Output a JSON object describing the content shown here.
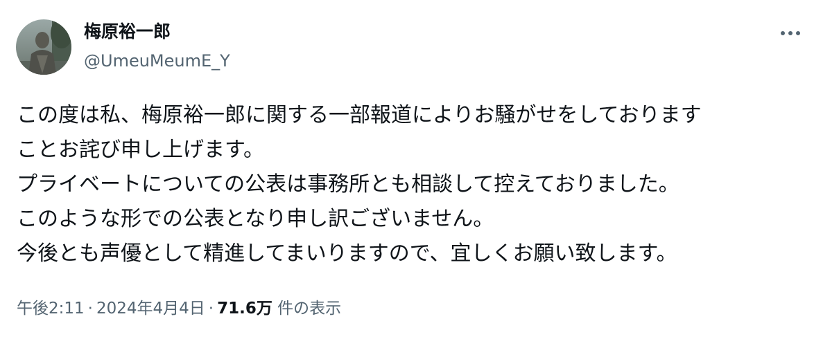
{
  "author": {
    "display_name": "梅原裕一郎",
    "handle": "@UmeuMeumE_Y",
    "avatar_icon": "avatar-photo-icon"
  },
  "more_menu": {
    "icon": "more-dots-icon"
  },
  "tweet": {
    "lines": [
      "この度は私、梅原裕一郎に関する一部報道によりお騒がせをしております",
      "ことお詫び申し上げます。",
      "プライベートについての公表は事務所とも相談して控えておりました。",
      "このような形での公表となり申し訳ございません。",
      "今後とも声優として精進してまいりますので、宜しくお願い致します。"
    ]
  },
  "meta": {
    "time": "午後2:11",
    "separator": "·",
    "date": "2024年4月4日",
    "views_count": "71.6万",
    "views_label": " 件の表示"
  },
  "colors": {
    "text_primary": "#0f1419",
    "text_secondary": "#536471",
    "background": "#ffffff"
  }
}
